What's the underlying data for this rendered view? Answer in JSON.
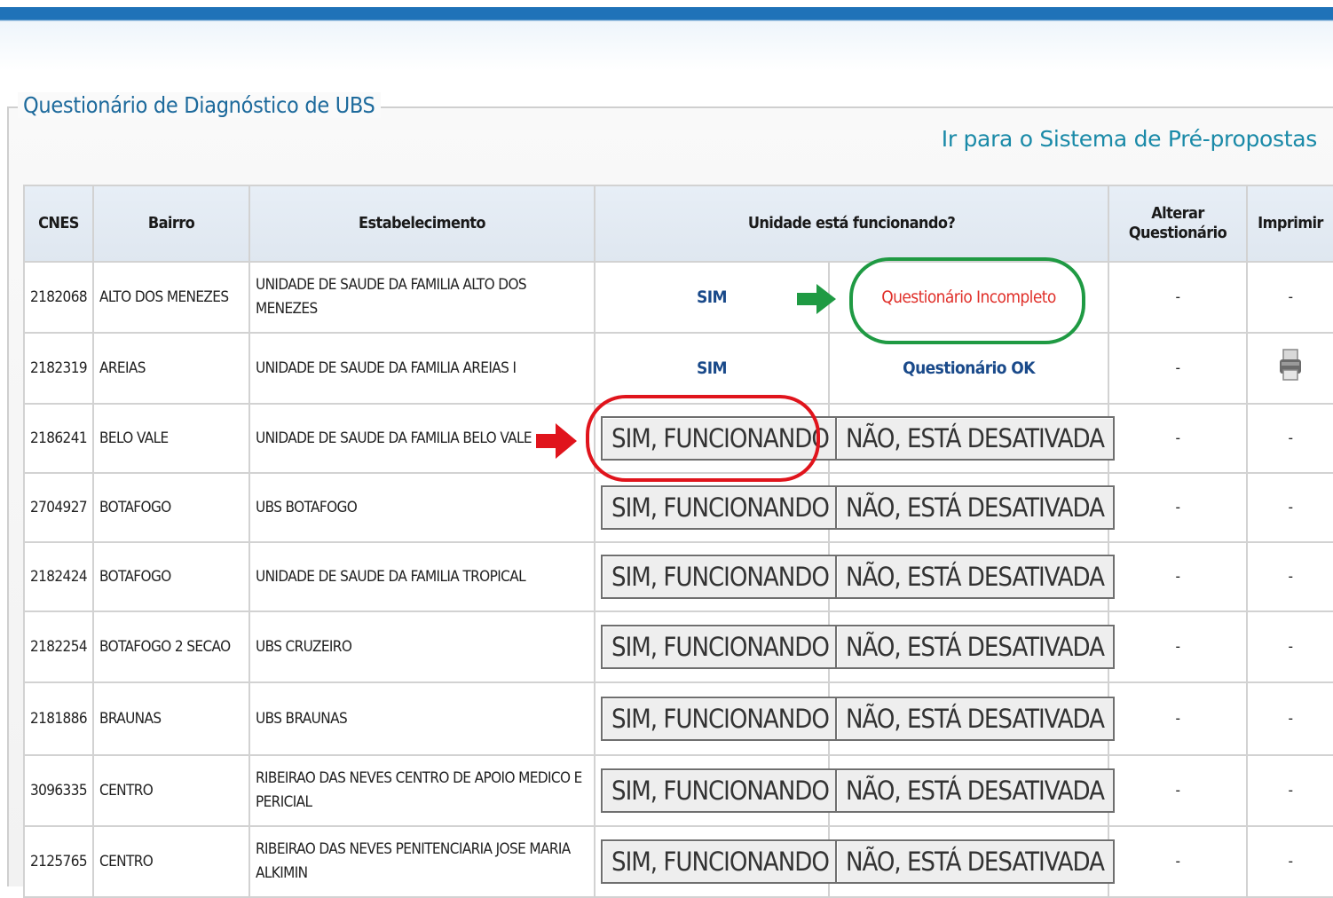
{
  "legend_title": "Questionário de Diagnóstico de UBS",
  "link_text": "Ir para o Sistema de Pré-propostas",
  "headers": {
    "cnes": "CNES",
    "bairro": "Bairro",
    "estabelecimento": "Estabelecimento",
    "funcionando": "Unidade está funcionando?",
    "alterar_l1": "Alterar",
    "alterar_l2": "Questionário",
    "imprimir": "Imprimir"
  },
  "rows": [
    {
      "cnes": "2182068",
      "bairro": "ALTO DOS MENEZES",
      "estab": "UNIDADE DE SAUDE DA FAMILIA ALTO DOS MENEZES",
      "answer": "SIM",
      "status": "Questionário Incompleto",
      "alterar": "-",
      "imprimir": "-"
    },
    {
      "cnes": "2182319",
      "bairro": "AREIAS",
      "estab": "UNIDADE DE SAUDE DA FAMILIA AREIAS I",
      "answer": "SIM",
      "status": "Questionário OK",
      "alterar": "-",
      "imprimir_icon": "printer-icon"
    },
    {
      "cnes": "2186241",
      "bairro": "BELO VALE",
      "estab": "UNIDADE DE SAUDE DA FAMILIA BELO VALE",
      "yes_btn": "SIM, FUNCIONANDO",
      "no_btn": "NÃO, ESTÁ DESATIVADA",
      "alterar": "-",
      "imprimir": "-"
    },
    {
      "cnes": "2704927",
      "bairro": "BOTAFOGO",
      "estab": "UBS BOTAFOGO",
      "yes_btn": "SIM, FUNCIONANDO",
      "no_btn": "NÃO, ESTÁ DESATIVADA",
      "alterar": "-",
      "imprimir": "-"
    },
    {
      "cnes": "2182424",
      "bairro": "BOTAFOGO",
      "estab": "UNIDADE DE SAUDE DA FAMILIA TROPICAL",
      "yes_btn": "SIM, FUNCIONANDO",
      "no_btn": "NÃO, ESTÁ DESATIVADA",
      "alterar": "-",
      "imprimir": "-"
    },
    {
      "cnes": "2182254",
      "bairro": "BOTAFOGO 2 SECAO",
      "estab": "UBS CRUZEIRO",
      "yes_btn": "SIM, FUNCIONANDO",
      "no_btn": "NÃO, ESTÁ DESATIVADA",
      "alterar": "-",
      "imprimir": "-"
    },
    {
      "cnes": "2181886",
      "bairro": "BRAUNAS",
      "estab": "UBS BRAUNAS",
      "yes_btn": "SIM, FUNCIONANDO",
      "no_btn": "NÃO, ESTÁ DESATIVADA",
      "alterar": "-",
      "imprimir": "-"
    },
    {
      "cnes": "3096335",
      "bairro": "CENTRO",
      "estab": "RIBEIRAO DAS NEVES CENTRO DE APOIO MEDICO E PERICIAL",
      "yes_btn": "SIM, FUNCIONANDO",
      "no_btn": "NÃO, ESTÁ DESATIVADA",
      "alterar": "-",
      "imprimir": "-"
    },
    {
      "cnes": "2125765",
      "bairro": "CENTRO",
      "estab": "RIBEIRAO DAS NEVES PENITENCIARIA JOSE MARIA ALKIMIN",
      "yes_btn": "SIM, FUNCIONANDO",
      "no_btn": "NÃO, ESTÁ DESATIVADA",
      "alterar": "-",
      "imprimir": "-"
    }
  ],
  "annotations": {
    "green": "#1f9a43",
    "red": "#e0141c"
  }
}
